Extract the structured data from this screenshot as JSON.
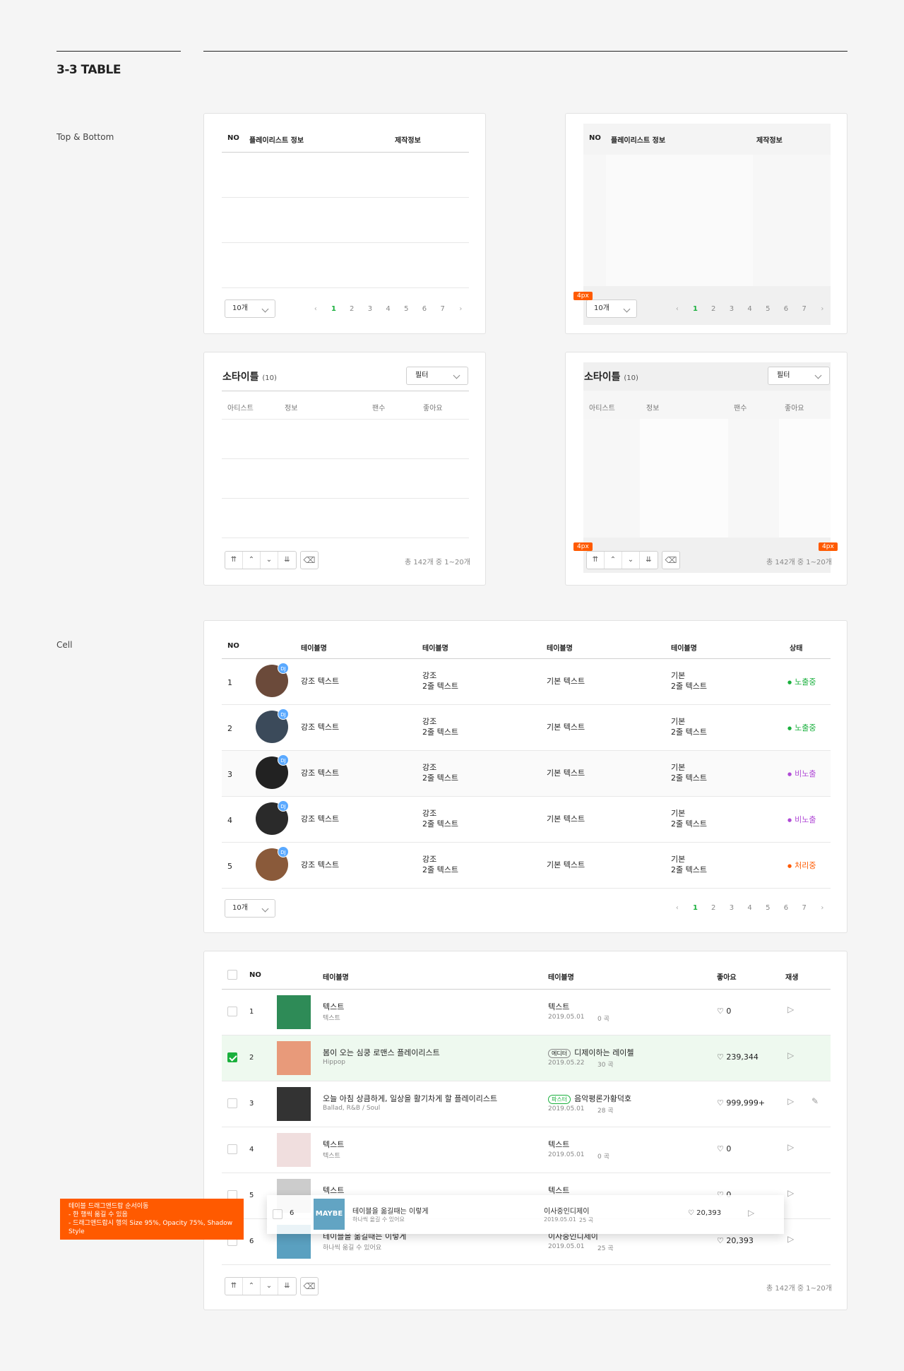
{
  "section": {
    "title": "3-3 TABLE",
    "label_top_bottom": "Top & Bottom",
    "label_cell": "Cell"
  },
  "tb": {
    "col_no": "NO",
    "col_playlist": "플레이리스트 정보",
    "col_make": "제작정보",
    "select": "10개",
    "pages": [
      "1",
      "2",
      "3",
      "4",
      "5",
      "6",
      "7"
    ],
    "prev": "‹",
    "next": "›",
    "tag": "4px"
  },
  "sub": {
    "title": "소타이틀",
    "count": "(10)",
    "filter": "필터",
    "col_artist": "아티스트",
    "col_info": "정보",
    "col_fans": "팬수",
    "col_like": "좋아요",
    "total": "총 142개 중 1~20개",
    "move": [
      "⇈",
      "⌃",
      "⌄",
      "⇊"
    ],
    "trash": "🗑"
  },
  "cell_table": {
    "headers": [
      "NO",
      "테이블명",
      "테이블명",
      "테이블명",
      "테이블명",
      "상태"
    ],
    "dj": "DJ",
    "rows": [
      {
        "no": "1",
        "c1": "강조 텍스트",
        "c2a": "강조",
        "c2b": "2줄 텍스트",
        "c3": "기본 텍스트",
        "c4a": "기본",
        "c4b": "2줄 텍스트",
        "status": "노출중",
        "status_color": "#1ab03d",
        "av": "#6b4a3a"
      },
      {
        "no": "2",
        "c1": "강조 텍스트",
        "c2a": "강조",
        "c2b": "2줄 텍스트",
        "c3": "기본 텍스트",
        "c4a": "기본",
        "c4b": "2줄 텍스트",
        "status": "노출중",
        "status_color": "#1ab03d",
        "av": "#3b4a5a"
      },
      {
        "no": "3",
        "c1": "강조 텍스트",
        "c2a": "강조",
        "c2b": "2줄 텍스트",
        "c3": "기본 텍스트",
        "c4a": "기본",
        "c4b": "2줄 텍스트",
        "status": "비노출",
        "status_color": "#b04ad6",
        "av": "#222222"
      },
      {
        "no": "4",
        "c1": "강조 텍스트",
        "c2a": "강조",
        "c2b": "2줄 텍스트",
        "c3": "기본 텍스트",
        "c4a": "기본",
        "c4b": "2줄 텍스트",
        "status": "비노출",
        "status_color": "#b04ad6",
        "av": "#2a2a2a"
      },
      {
        "no": "5",
        "c1": "강조 텍스트",
        "c2a": "강조",
        "c2b": "2줄 텍스트",
        "c3": "기본 텍스트",
        "c4a": "기본",
        "c4b": "2줄 텍스트",
        "status": "처리중",
        "status_color": "#ff5a00",
        "av": "#8a5a3a"
      }
    ],
    "select": "10개"
  },
  "list_table": {
    "headers": {
      "no": "NO",
      "name": "테이블명",
      "name2": "테이블명",
      "like": "좋아요",
      "play": "재생"
    },
    "rows": [
      {
        "no": "1",
        "title": "텍스트",
        "sub": "텍스트",
        "badge": "",
        "maker": "텍스트",
        "date": "2019.05.01",
        "songs": "0 곡",
        "likes": "0",
        "checked": false,
        "thumb": "#2e8b57"
      },
      {
        "no": "2",
        "title": "봄이 오는 심쿵 로맨스 플레이리스트",
        "sub": "Hippop",
        "badge": "에디터",
        "maker": "디제이하는 레이첼",
        "date": "2019.05.22",
        "songs": "30 곡",
        "likes": "239,344",
        "checked": true,
        "thumb": "#e89a7a"
      },
      {
        "no": "3",
        "title": "오늘 아침 상큼하게, 일상을 활기차게 할 플레이리스트",
        "sub": "Ballad, R&B / Soul",
        "badge": "파스터",
        "maker": "음악평론가황덕호",
        "date": "2019.05.01",
        "songs": "28 곡",
        "likes": "999,999+",
        "checked": false,
        "thumb": "#333333"
      },
      {
        "no": "4",
        "title": "텍스트",
        "sub": "텍스트",
        "badge": "",
        "maker": "텍스트",
        "date": "2019.05.01",
        "songs": "0 곡",
        "likes": "0",
        "checked": false,
        "thumb": "#f0dede"
      },
      {
        "no": "5",
        "title": "텍스트",
        "sub": "",
        "badge": "",
        "maker": "텍스트",
        "date": "",
        "songs": "",
        "likes": "0",
        "checked": false,
        "thumb": "#cccccc"
      },
      {
        "no": "6",
        "title": "테이블을 옮길때는 이렇게",
        "sub": "하나씩 옮길 수 있어요",
        "badge": "",
        "maker": "이사중인디제이",
        "date": "2019.05.01",
        "songs": "25 곡",
        "likes": "20,393",
        "checked": false,
        "thumb": "#5aa0c0"
      }
    ],
    "drag": {
      "no": "6",
      "title": "테이블을 옮길때는 이렇게",
      "sub": "하나씩 옮길 수 있어요",
      "maker": "이사중인디제이",
      "date": "2019.05.01",
      "songs": "25 곡",
      "likes": "20,393",
      "thumb_text": "MAYBE"
    },
    "note": [
      "테이블 드래그앤드랍 순서이동",
      "- 한 행씩 옮길 수 있음",
      "- 드래그앤드랍시 행의 Size 95%, Opacity 75%, Shadow Style"
    ]
  }
}
